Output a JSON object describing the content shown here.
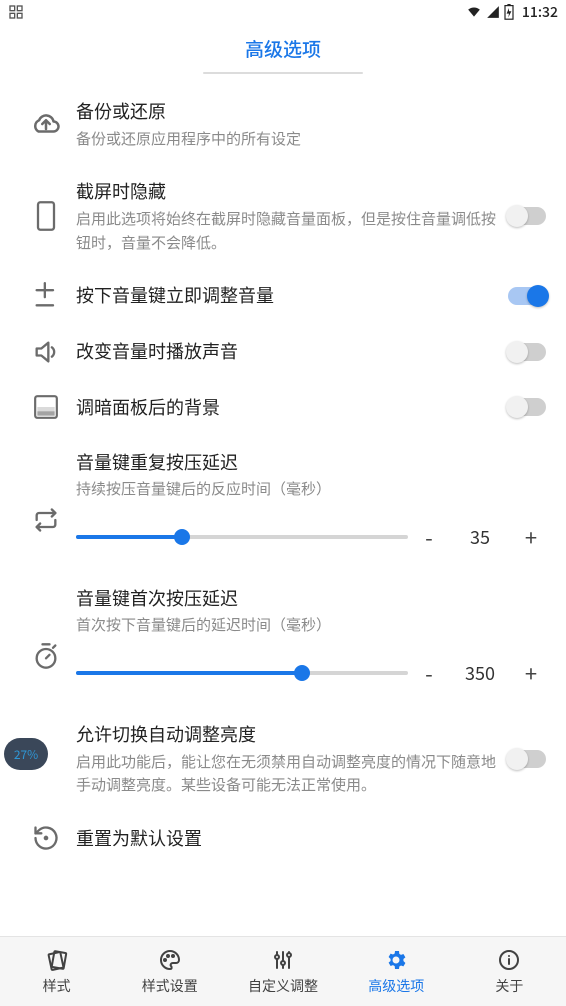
{
  "status": {
    "time": "11:32"
  },
  "header": {
    "title": "高级选项"
  },
  "rows": {
    "backup": {
      "title": "备份或还原",
      "desc": "备份或还原应用程序中的所有设定"
    },
    "hide": {
      "title": "截屏时隐藏",
      "desc": "启用此选项将始终在截屏时隐藏音量面板，但是按住音量调低按钮时，音量不会降低。"
    },
    "instant": {
      "title": "按下音量键立即调整音量"
    },
    "sound": {
      "title": "改变音量时播放声音"
    },
    "dim": {
      "title": "调暗面板后的背景"
    },
    "repeat": {
      "title": "音量键重复按压延迟",
      "desc": "持续按压音量键后的反应时间（毫秒）",
      "value": "35"
    },
    "first": {
      "title": "音量键首次按压延迟",
      "desc": "首次按下音量键后的延迟时间（毫秒）",
      "value": "350"
    },
    "bright": {
      "title": "允许切换自动调整亮度",
      "desc": "启用此功能后，能让您在无须禁用自动调整亮度的情况下随意地手动调整亮度。某些设备可能无法正常使用。"
    },
    "reset": {
      "title": "重置为默认设置"
    }
  },
  "slider": {
    "minus": "-",
    "plus": "+"
  },
  "badge": {
    "text": "27%"
  },
  "tabs": {
    "style": "样式",
    "styleset": "样式设置",
    "custom": "自定义调整",
    "adv": "高级选项",
    "about": "关于"
  }
}
